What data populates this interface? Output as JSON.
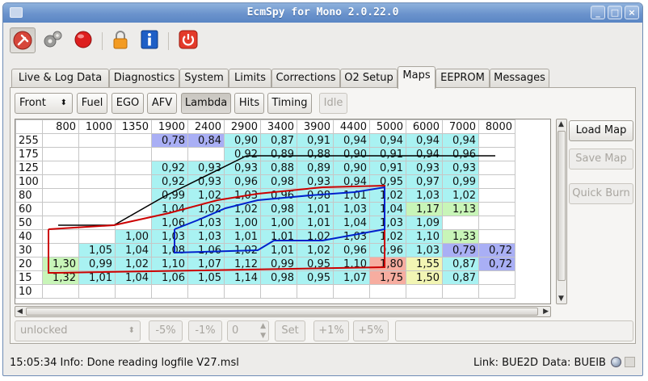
{
  "window": {
    "title": "EcmSpy for Mono 2.0.22.0"
  },
  "tabs": [
    "Live & Log Data",
    "Diagnostics",
    "System",
    "Limits",
    "Corrections",
    "O2 Setup",
    "Maps",
    "EEPROM",
    "Messages"
  ],
  "active_tab": "Maps",
  "map_toolbar": {
    "cylinder_select": "Front",
    "fuel": "Fuel",
    "ego": "EGO",
    "afv": "AFV",
    "lambda": "Lambda",
    "hits": "Hits",
    "timing": "Timing",
    "idle": "Idle"
  },
  "side_buttons": {
    "load_map": "Load Map",
    "save_map": "Save Map",
    "quick_burn": "Quick Burn"
  },
  "colors": {
    "purple": "#a9aff5",
    "cyan": "#a9f2f2",
    "green": "#c8f5b8",
    "yellow": "#f2f5b4",
    "salmon": "#f7ada0",
    "blank": "#ffffff"
  },
  "map": {
    "rpm": [
      "800",
      "1000",
      "1350",
      "1900",
      "2400",
      "2900",
      "3400",
      "3900",
      "4400",
      "5000",
      "6000",
      "7000",
      "8000"
    ],
    "rows": [
      {
        "load": "255",
        "cells": [
          "",
          "",
          "",
          "0,78",
          "0,84",
          "0,90",
          "0,87",
          "0,91",
          "0,94",
          "0,94",
          "0,94",
          "0,94",
          ""
        ],
        "colors": [
          "blank",
          "blank",
          "blank",
          "purple",
          "purple",
          "cyan",
          "cyan",
          "cyan",
          "cyan",
          "cyan",
          "cyan",
          "cyan",
          "blank"
        ]
      },
      {
        "load": "175",
        "cells": [
          "",
          "",
          "",
          "",
          "",
          "0,92",
          "0,89",
          "0,88",
          "0,90",
          "0,91",
          "0,94",
          "0,96",
          ""
        ],
        "colors": [
          "blank",
          "blank",
          "blank",
          "blank",
          "blank",
          "cyan",
          "cyan",
          "cyan",
          "cyan",
          "cyan",
          "cyan",
          "cyan",
          "blank"
        ]
      },
      {
        "load": "125",
        "cells": [
          "",
          "",
          "",
          "0,92",
          "0,93",
          "0,93",
          "0,88",
          "0,89",
          "0,90",
          "0,91",
          "0,93",
          "0,93",
          ""
        ],
        "colors": [
          "blank",
          "blank",
          "blank",
          "cyan",
          "cyan",
          "cyan",
          "cyan",
          "cyan",
          "cyan",
          "cyan",
          "cyan",
          "cyan",
          "blank"
        ]
      },
      {
        "load": "100",
        "cells": [
          "",
          "",
          "",
          "0,92",
          "0,93",
          "0,96",
          "0,98",
          "0,93",
          "0,94",
          "0,95",
          "0,97",
          "0,99",
          ""
        ],
        "colors": [
          "blank",
          "blank",
          "blank",
          "cyan",
          "cyan",
          "cyan",
          "cyan",
          "cyan",
          "cyan",
          "cyan",
          "cyan",
          "cyan",
          "blank"
        ]
      },
      {
        "load": "80",
        "cells": [
          "",
          "",
          "",
          "0,99",
          "1,02",
          "1,03",
          "0,96",
          "0,98",
          "1,01",
          "1,02",
          "1,03",
          "1,02",
          ""
        ],
        "colors": [
          "blank",
          "blank",
          "blank",
          "cyan",
          "cyan",
          "cyan",
          "cyan",
          "cyan",
          "cyan",
          "cyan",
          "cyan",
          "cyan",
          "blank"
        ]
      },
      {
        "load": "60",
        "cells": [
          "",
          "",
          "",
          "1,04",
          "1,02",
          "1,02",
          "0,98",
          "1,01",
          "1,03",
          "1,04",
          "1,17",
          "1,13",
          ""
        ],
        "colors": [
          "blank",
          "blank",
          "blank",
          "cyan",
          "cyan",
          "cyan",
          "cyan",
          "cyan",
          "cyan",
          "cyan",
          "green",
          "green",
          "blank"
        ]
      },
      {
        "load": "50",
        "cells": [
          "",
          "",
          "",
          "1,06",
          "1,03",
          "1,00",
          "1,00",
          "1,01",
          "1,04",
          "1,03",
          "1,09",
          "",
          ""
        ],
        "colors": [
          "blank",
          "blank",
          "blank",
          "cyan",
          "cyan",
          "cyan",
          "cyan",
          "cyan",
          "cyan",
          "cyan",
          "cyan",
          "blank",
          "blank"
        ]
      },
      {
        "load": "40",
        "cells": [
          "",
          "",
          "1,00",
          "1,03",
          "1,03",
          "1,01",
          "1,01",
          "1,02",
          "1,03",
          "1,02",
          "1,10",
          "1,33",
          ""
        ],
        "colors": [
          "blank",
          "blank",
          "cyan",
          "cyan",
          "cyan",
          "cyan",
          "cyan",
          "cyan",
          "cyan",
          "cyan",
          "cyan",
          "green",
          "blank"
        ]
      },
      {
        "load": "30",
        "cells": [
          "",
          "1,05",
          "1,04",
          "1,08",
          "1,06",
          "1,02",
          "1,01",
          "1,02",
          "0,96",
          "0,96",
          "1,03",
          "0,79",
          "0,72"
        ],
        "colors": [
          "blank",
          "cyan",
          "cyan",
          "cyan",
          "cyan",
          "cyan",
          "cyan",
          "cyan",
          "cyan",
          "cyan",
          "cyan",
          "purple",
          "purple"
        ]
      },
      {
        "load": "20",
        "cells": [
          "1,30",
          "0,99",
          "1,02",
          "1,10",
          "1,07",
          "1,12",
          "0,99",
          "0,95",
          "1,10",
          "1,80",
          "1,55",
          "0,87",
          "0,72"
        ],
        "colors": [
          "green",
          "cyan",
          "cyan",
          "cyan",
          "cyan",
          "cyan",
          "cyan",
          "cyan",
          "cyan",
          "salmon",
          "yellow",
          "cyan",
          "purple"
        ]
      },
      {
        "load": "15",
        "cells": [
          "1,32",
          "1,01",
          "1,04",
          "1,06",
          "1,05",
          "1,14",
          "0,98",
          "0,95",
          "1,07",
          "1,75",
          "1,50",
          "0,87",
          ""
        ],
        "colors": [
          "green",
          "cyan",
          "cyan",
          "cyan",
          "cyan",
          "cyan",
          "cyan",
          "cyan",
          "cyan",
          "salmon",
          "yellow",
          "cyan",
          "blank"
        ]
      },
      {
        "load": "10",
        "cells": [
          "",
          "",
          "",
          "",
          "",
          "",
          "",
          "",
          "",
          "",
          "",
          "",
          ""
        ],
        "colors": [
          "blank",
          "blank",
          "blank",
          "blank",
          "blank",
          "blank",
          "blank",
          "blank",
          "blank",
          "blank",
          "blank",
          "blank",
          "blank"
        ]
      }
    ]
  },
  "bottom_controls": {
    "lock_state": "unlocked",
    "minus5": "-5%",
    "minus1": "-1%",
    "spin_value": "0",
    "set": "Set",
    "plus1": "+1%",
    "plus5": "+5%",
    "text_value": ""
  },
  "status": {
    "message": "15:05:34 Info: Done reading logfile V27.msl",
    "link": "Link: BUE2D",
    "data": "Data: BUEIB"
  }
}
